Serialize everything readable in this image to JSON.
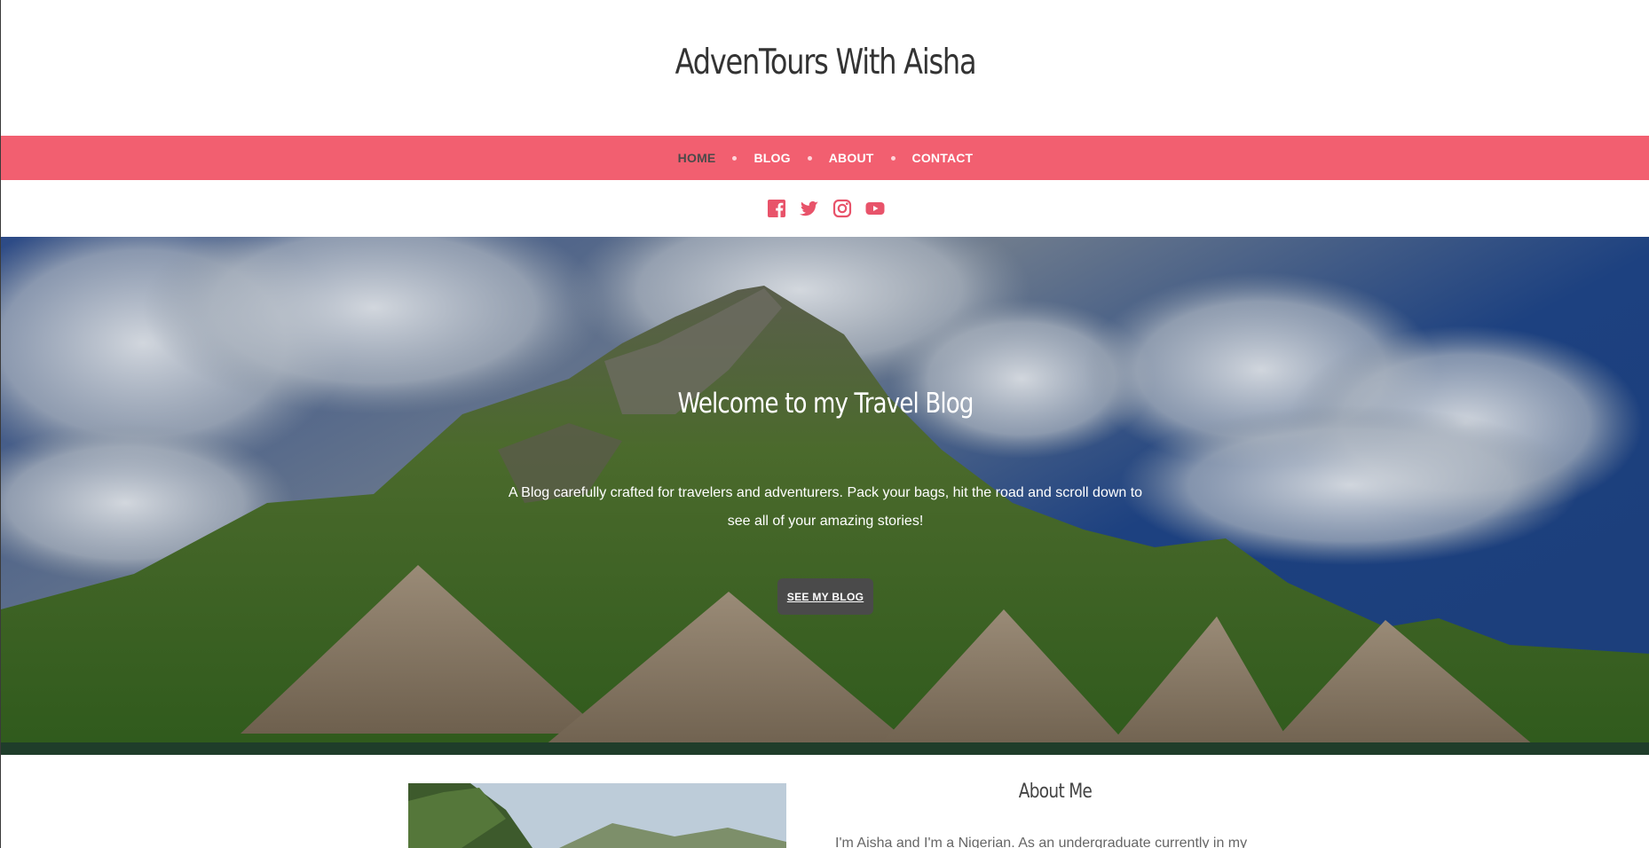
{
  "site": {
    "title": "AdvenTours With Aisha"
  },
  "nav": {
    "items": [
      {
        "label": "HOME",
        "active": true
      },
      {
        "label": "BLOG",
        "active": false
      },
      {
        "label": "ABOUT",
        "active": false
      },
      {
        "label": "CONTACT",
        "active": false
      }
    ]
  },
  "social": {
    "icons": [
      "facebook-icon",
      "twitter-icon",
      "instagram-icon",
      "youtube-icon"
    ],
    "color": "#e8536a"
  },
  "hero": {
    "title": "Welcome to my Travel Blog",
    "subtitle": "A Blog carefully crafted for travelers and adventurers. Pack your bags, hit the road and scroll down to see all of your amazing stories!",
    "button_label": "SEE MY BLOG"
  },
  "about": {
    "title": "About Me",
    "text": "I'm Aisha and I'm a Nigerian. As an undergraduate currently in my"
  },
  "colors": {
    "accent": "#f25f70",
    "button": "#4a4a4a"
  }
}
